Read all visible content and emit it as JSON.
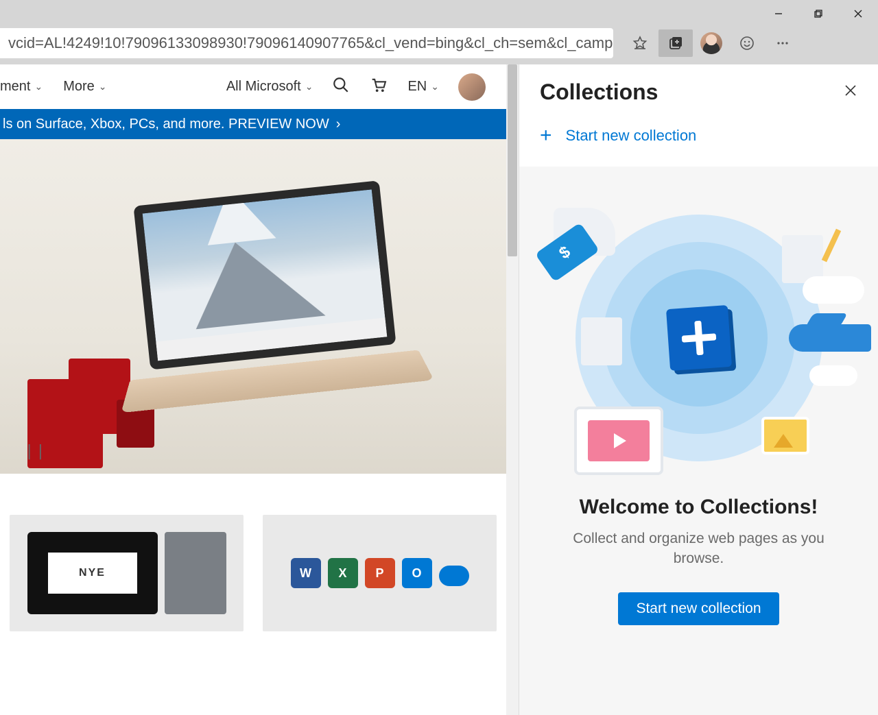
{
  "window": {
    "url_fragment": "vcid=AL!4249!10!79096133098930!79096140907765&cl_vend=bing&cl_ch=sem&cl_camp=..."
  },
  "site_nav": {
    "item_partial": "ment",
    "more": "More",
    "all_ms": "All Microsoft",
    "lang": "EN"
  },
  "banner": {
    "text": "ls on Surface, Xbox, PCs, and more. PREVIEW NOW"
  },
  "hero": {
    "pause_glyph": "||"
  },
  "collections": {
    "title": "Collections",
    "start_link": "Start new collection",
    "welcome_title": "Welcome to Collections!",
    "welcome_sub": "Collect and organize web pages as you browse.",
    "start_button": "Start new collection"
  }
}
